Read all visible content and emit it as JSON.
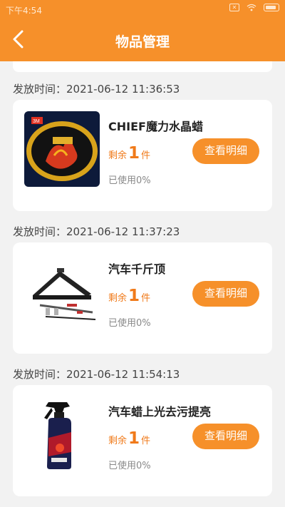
{
  "status": {
    "time": "下午4:54",
    "icons": [
      "notification-box-icon",
      "wifi-icon",
      "battery-icon"
    ]
  },
  "header": {
    "title": "物品管理",
    "back_icon": "chevron-left-icon"
  },
  "colors": {
    "accent": "#f6902a",
    "accent_text": "#f07a1a"
  },
  "items": [
    {
      "timestamp": "发放时间：2021-06-12 11:36:53",
      "name": "CHIEF魔力水晶蜡",
      "remain_prefix": "剩余",
      "remain_count": "1",
      "remain_unit": "件",
      "used": "已使用0%",
      "button": "查看明细",
      "image": "wax-tin-image"
    },
    {
      "timestamp": "发放时间：2021-06-12 11:37:23",
      "name": "汽车千斤顶",
      "remain_prefix": "剩余",
      "remain_count": "1",
      "remain_unit": "件",
      "used": "已使用0%",
      "button": "查看明细",
      "image": "car-jack-image"
    },
    {
      "timestamp": "发放时间：2021-06-12 11:54:13",
      "name": "汽车蜡上光去污提亮",
      "remain_prefix": "剩余",
      "remain_count": "1",
      "remain_unit": "件",
      "used": "已使用0%",
      "button": "查看明细",
      "image": "spray-bottle-image"
    }
  ]
}
